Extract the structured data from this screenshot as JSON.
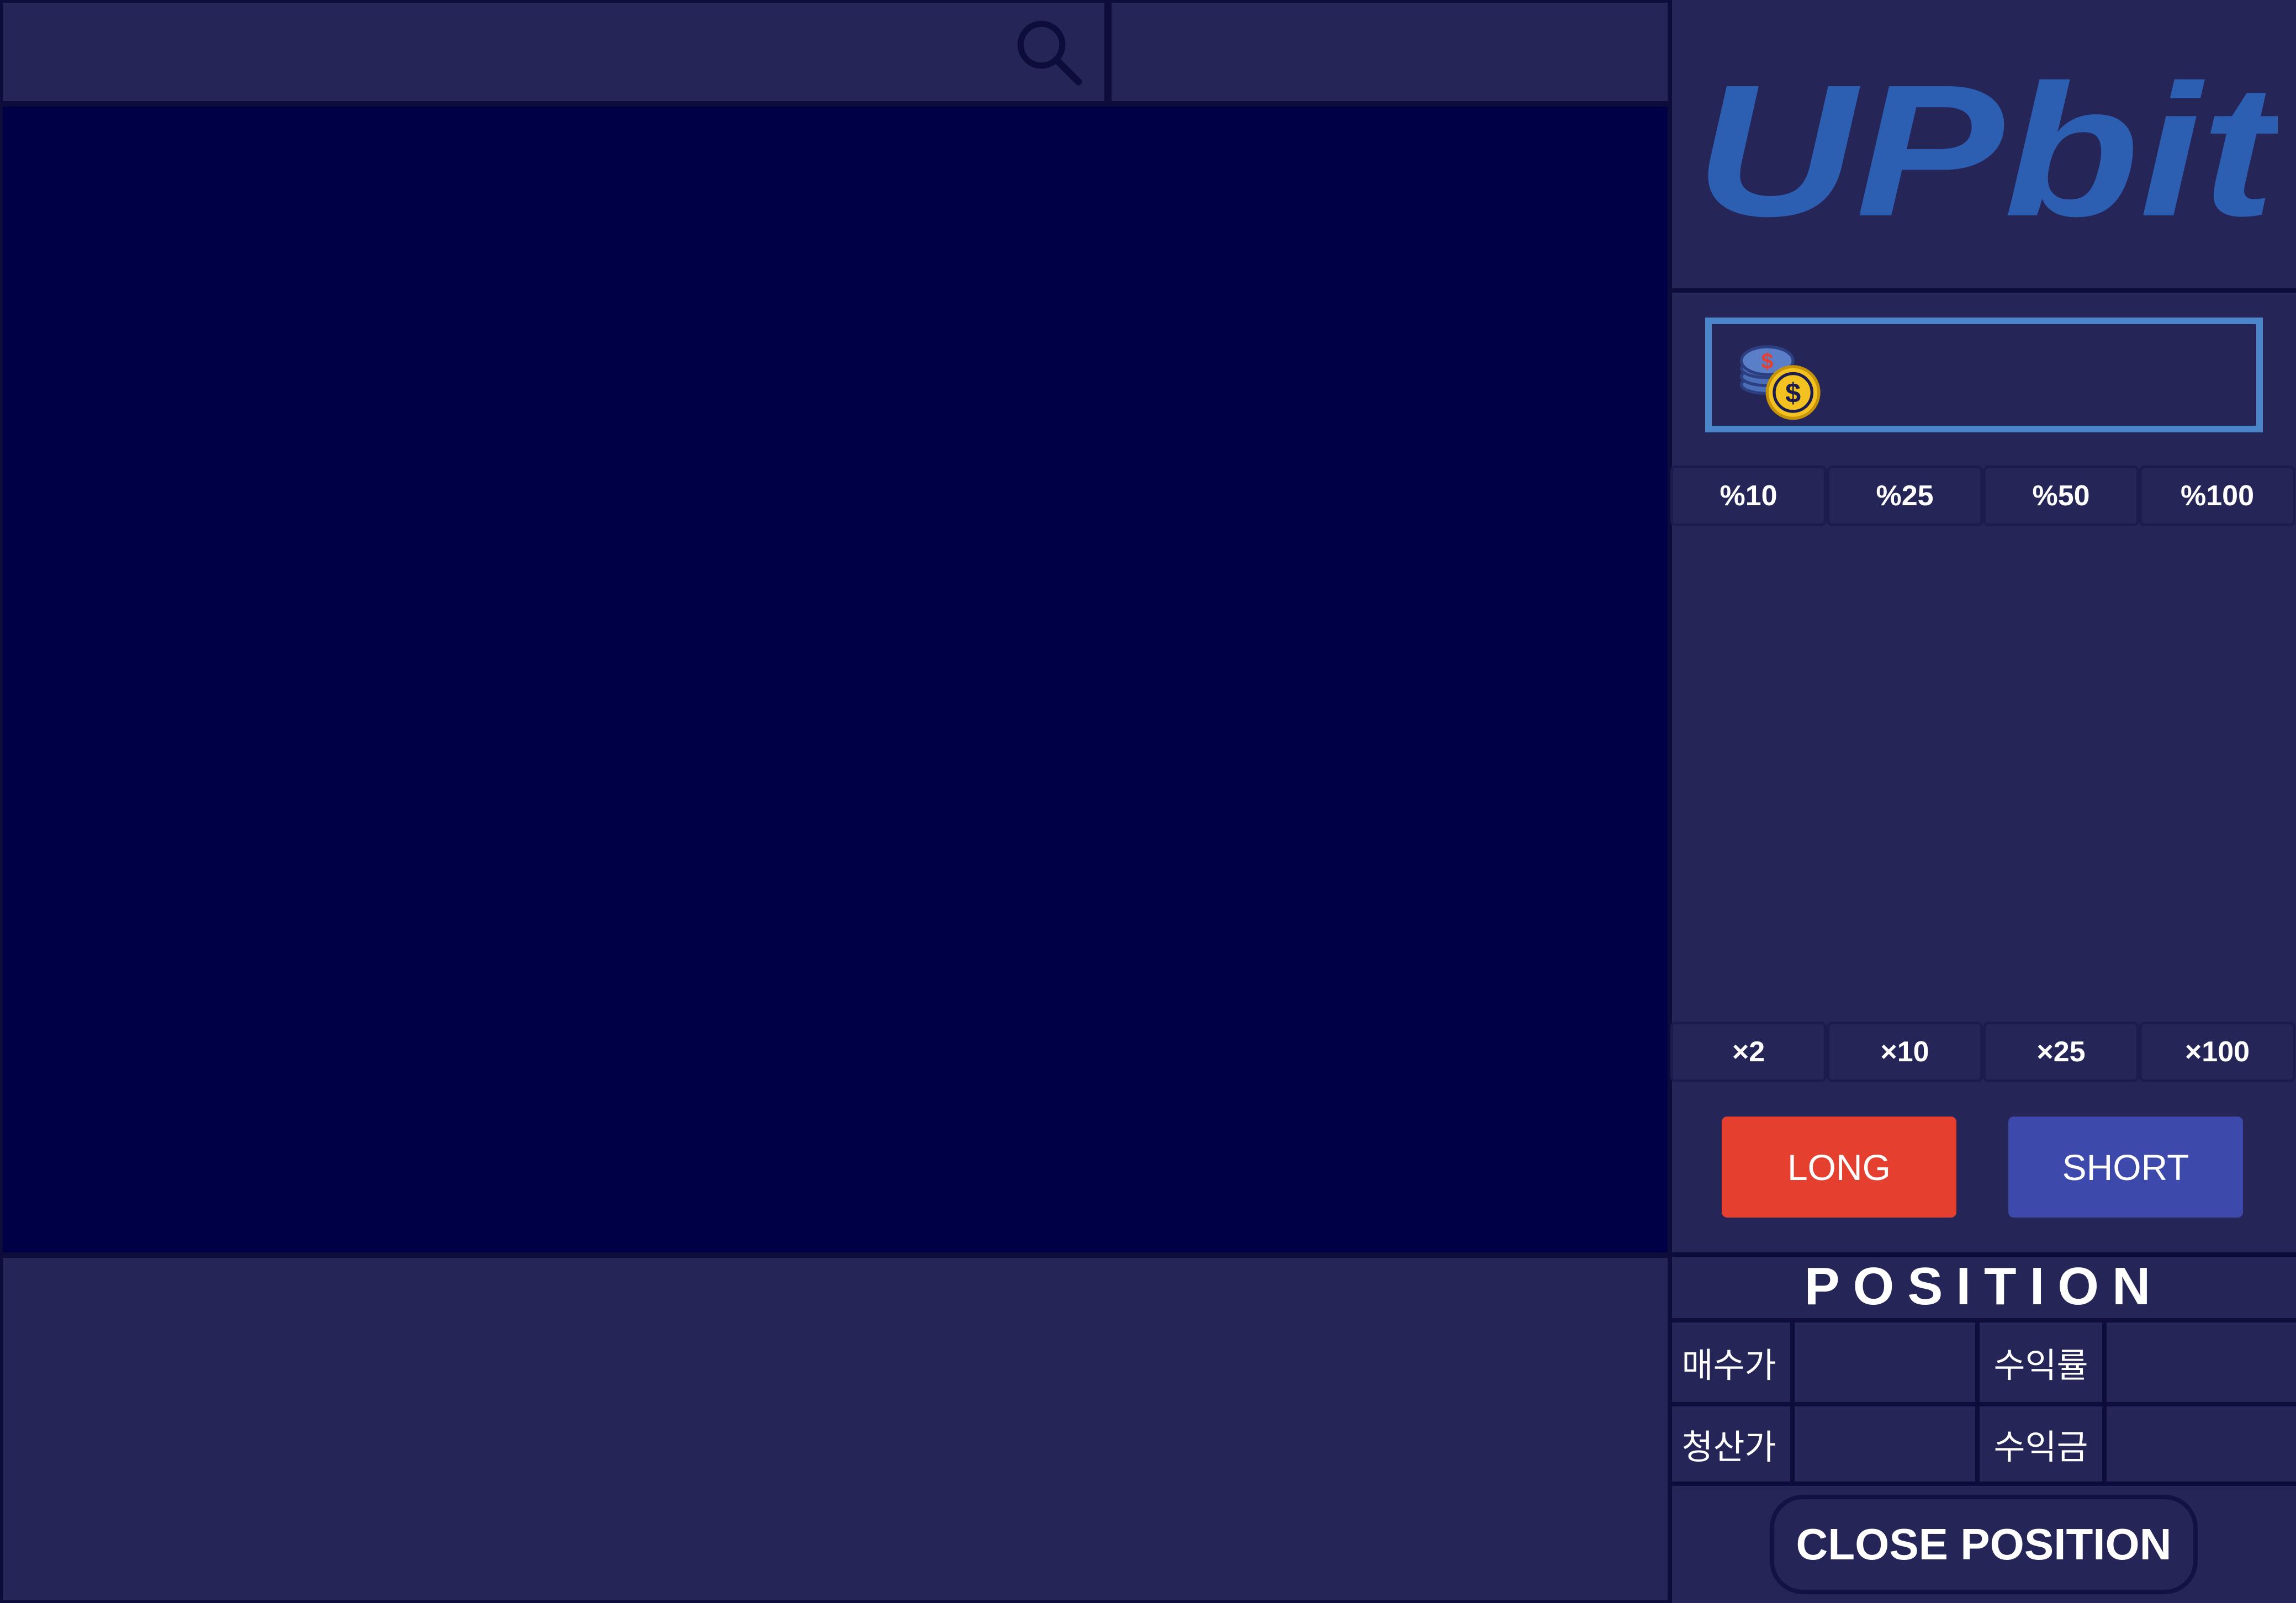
{
  "search": {
    "placeholder": "",
    "icon": "search-icon"
  },
  "logo": {
    "text": "UPbit",
    "color": "#2c5fb2"
  },
  "amount": {
    "value": "",
    "placeholder": "",
    "icon": "coins-icon"
  },
  "percent_buttons": [
    {
      "label": "%10"
    },
    {
      "label": "%25"
    },
    {
      "label": "%50"
    },
    {
      "label": "%100"
    }
  ],
  "leverage_buttons": [
    {
      "label": "×2"
    },
    {
      "label": "×10"
    },
    {
      "label": "×25"
    },
    {
      "label": "×100"
    }
  ],
  "actions": {
    "long_label": "LONG",
    "short_label": "SHORT",
    "long_color": "#e5402f",
    "short_color": "#3d4aac"
  },
  "position": {
    "title": "POSITION",
    "rows": [
      {
        "label_1": "매수가",
        "value_1": "",
        "label_2": "수익률",
        "value_2": ""
      },
      {
        "label_1": "청산가",
        "value_1": "",
        "label_2": "수익금",
        "value_2": ""
      }
    ],
    "close_label": "CLOSE POSITION"
  },
  "colors": {
    "background": "#262558",
    "chart_background": "#000046",
    "input_border": "#4b86ca"
  }
}
